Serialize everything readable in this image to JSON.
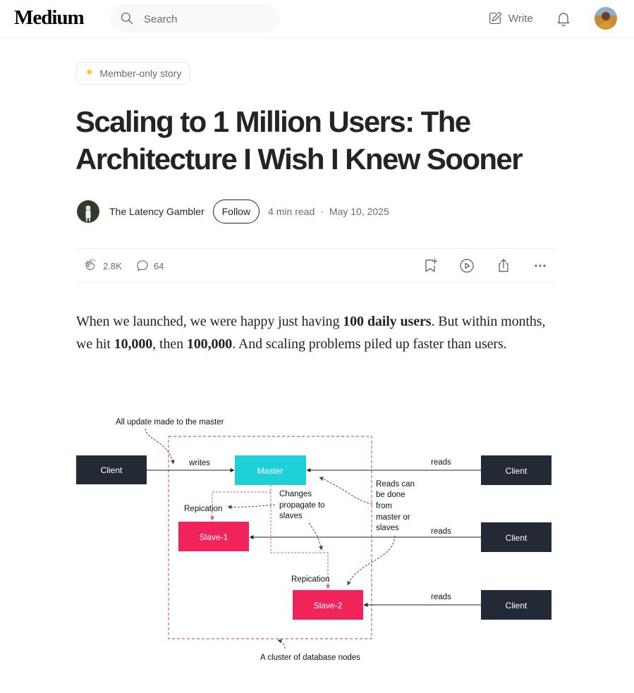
{
  "brand": {
    "logo": "Medium"
  },
  "search": {
    "placeholder": "Search"
  },
  "nav": {
    "write_label": "Write"
  },
  "badge": {
    "label": "Member-only story"
  },
  "article": {
    "title": "Scaling to 1 Million Users: The Architecture I Wish I Knew Sooner",
    "author": "The Latency Gambler",
    "follow_label": "Follow",
    "read_time": "4 min read",
    "separator": "·",
    "date": "May 10, 2025",
    "claps": "2.8K",
    "responses": "64",
    "intro": {
      "p1": "When we launched, we were happy just having ",
      "b1": "100 daily users",
      "p2": ". But within months, we hit ",
      "b2": "10,000",
      "p3": ", then ",
      "b3": "100,000",
      "p4": ". And scaling problems piled up faster than users."
    }
  },
  "diagram": {
    "note_master": "All update made to the master",
    "client": "Client",
    "writes": "writes",
    "reads": "reads",
    "master": "Master",
    "slave1": "Slave-1",
    "slave2": "Slave-2",
    "replication": "Repication",
    "changes": [
      "Changes",
      "propagate to",
      "slaves"
    ],
    "reads_note": [
      "Reads can",
      "be done",
      "from",
      "master or",
      "slaves"
    ],
    "cluster": "A cluster of database nodes"
  },
  "colors": {
    "master": "#1fd1d6",
    "slave": "#f0245a",
    "client": "#232a35",
    "accent_star": "#ffc017",
    "cluster_border": "#e8557a"
  }
}
